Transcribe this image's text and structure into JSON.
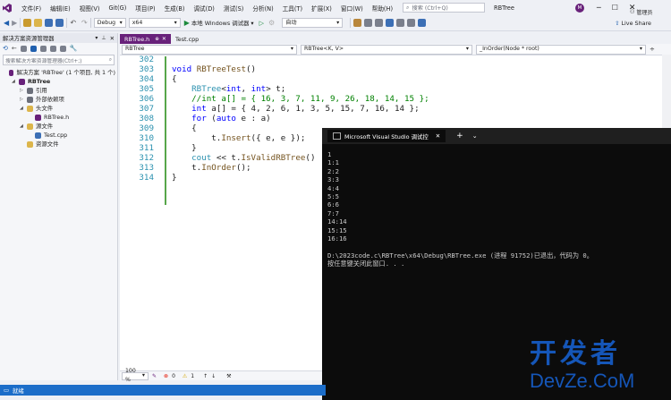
{
  "colors": {
    "accent": "#68217a",
    "status_bar": "#1b6dc9",
    "console_bg": "#0c0c0c",
    "watermark_blue": "#1556b8",
    "watermark_orange": "#e3701d",
    "gutter_green": "#57a64a"
  },
  "menu": {
    "items": [
      "文件(F)",
      "编辑(E)",
      "视图(V)",
      "Git(G)",
      "项目(P)",
      "生成(B)",
      "调试(D)",
      "测试(S)",
      "分析(N)",
      "工具(T)",
      "扩展(X)",
      "窗口(W)",
      "帮助(H)"
    ],
    "search_placeholder": "搜索 (Ctrl+Q)",
    "solution_name": "RBTree",
    "avatar": "M"
  },
  "toolbar": {
    "config": "Debug",
    "platform": "x64",
    "run_label": "本地 Windows 调试器",
    "auto": "自动",
    "live_share": "Live Share",
    "admin": "管理员"
  },
  "solution_explorer": {
    "title": "解决方案资源管理器",
    "search_placeholder": "搜索解决方案资源管理器(Ctrl+;)",
    "items": [
      {
        "label": "解决方案 'RBTree' (1 个项目, 共 1 个)",
        "depth": 0,
        "icon": "solution-icon"
      },
      {
        "label": "RBTree",
        "depth": 1,
        "icon": "project-icon",
        "bold": true
      },
      {
        "label": "引用",
        "depth": 2,
        "icon": "references-icon"
      },
      {
        "label": "外部依赖项",
        "depth": 2,
        "icon": "external-deps-icon"
      },
      {
        "label": "头文件",
        "depth": 2,
        "icon": "folder-icon"
      },
      {
        "label": "RBTree.h",
        "depth": 3,
        "icon": "header-file-icon"
      },
      {
        "label": "源文件",
        "depth": 2,
        "icon": "folder-icon"
      },
      {
        "label": "Test.cpp",
        "depth": 3,
        "icon": "cpp-file-icon"
      },
      {
        "label": "资源文件",
        "depth": 2,
        "icon": "folder-icon"
      }
    ]
  },
  "editor": {
    "tabs": [
      {
        "label": "RBTree.h",
        "active": true
      },
      {
        "label": "Test.cpp",
        "active": false
      }
    ],
    "nav": [
      "RBTree",
      "RBTree<K, V>",
      "_InOrder(Node * root)"
    ],
    "zoom": "100 %",
    "errors": "0",
    "warnings": "1",
    "lines": [
      {
        "n": "302",
        "t": ""
      },
      {
        "n": "303",
        "t": "void RBTreeTest()"
      },
      {
        "n": "304",
        "t": "{"
      },
      {
        "n": "305",
        "t": "    RBTree<int, int> t;"
      },
      {
        "n": "306",
        "t": "    //int a[] = { 16, 3, 7, 11, 9, 26, 18, 14, 15 };"
      },
      {
        "n": "307",
        "t": "    int a[] = { 4, 2, 6, 1, 3, 5, 15, 7, 16, 14 };"
      },
      {
        "n": "308",
        "t": "    for (auto e : a)"
      },
      {
        "n": "309",
        "t": "    {"
      },
      {
        "n": "310",
        "t": "        t.Insert({ e, e });"
      },
      {
        "n": "311",
        "t": "    }"
      },
      {
        "n": "312",
        "t": "    cout << t.IsValidRBTree()"
      },
      {
        "n": "313",
        "t": "    t.InOrder();"
      },
      {
        "n": "314",
        "t": "}"
      }
    ]
  },
  "console": {
    "title": "Microsoft Visual Studio 调试控",
    "lines": [
      "1",
      "1:1",
      "2:2",
      "3:3",
      "4:4",
      "5:5",
      "6:6",
      "7:7",
      "14:14",
      "15:15",
      "16:16",
      "",
      "D:\\2023code.c\\RBTree\\x64\\Debug\\RBTree.exe (进程 91752)已退出，代码为 0。",
      "按任意键关闭此窗口. . ."
    ]
  },
  "status": {
    "ready": "就绪"
  },
  "watermark": {
    "line1": "开发者",
    "line2": "DevZe.CoM"
  }
}
